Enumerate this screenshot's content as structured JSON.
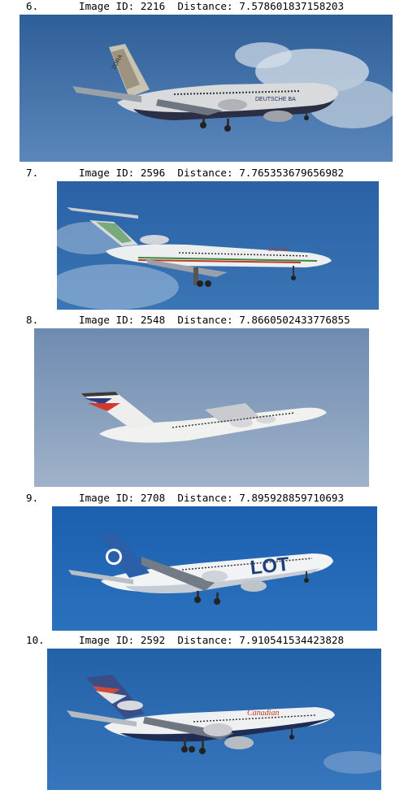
{
  "results": [
    {
      "rank": "6.",
      "image_id_label": "Image ID:",
      "image_id": "2216",
      "distance_label": "Distance:",
      "distance": "7.578601837158203",
      "photo_subject": "airliner-photo",
      "sky_color": "#3f6fa8",
      "livery_text": "DEUTSCHE BA",
      "fin_text": "ZORA"
    },
    {
      "rank": "7.",
      "image_id_label": "Image ID:",
      "image_id": "2596",
      "distance_label": "Distance:",
      "distance": "7.765353679656982",
      "photo_subject": "airliner-photo",
      "sky_color": "#2f6cad",
      "livery_text": "BALKAN"
    },
    {
      "rank": "8.",
      "image_id_label": "Image ID:",
      "image_id": "2548",
      "distance_label": "Distance:",
      "distance": "7.8660502433776855",
      "photo_subject": "airliner-photo",
      "sky_color": "#7d97b8"
    },
    {
      "rank": "9.",
      "image_id_label": "Image ID:",
      "image_id": "2708",
      "distance_label": "Distance:",
      "distance": "7.895928859710693",
      "photo_subject": "airliner-photo",
      "sky_color": "#1f66b5",
      "livery_text": "LOT"
    },
    {
      "rank": "10.",
      "image_id_label": "Image ID:",
      "image_id": "2592",
      "distance_label": "Distance:",
      "distance": "7.910541534423828",
      "photo_subject": "airliner-photo",
      "sky_color": "#2868ad",
      "livery_text": "Canadian"
    }
  ]
}
